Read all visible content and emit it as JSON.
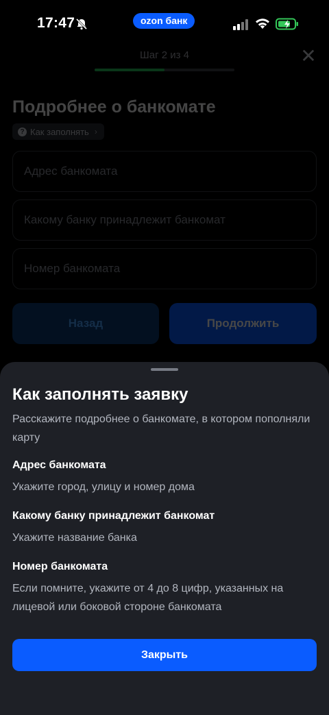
{
  "status_bar": {
    "time": "17:47",
    "bank_badge": "ozon банк",
    "icons": [
      "bell-slash-icon",
      "cellular-signal-icon",
      "wifi-icon",
      "battery-charging-icon"
    ]
  },
  "page": {
    "step": "Шаг 2 из 4",
    "progress_fraction": 0.5,
    "title": "Подробнее о банкомате",
    "how_to_fill": "Как заполнять",
    "fields": {
      "address_placeholder": "Адрес банкомата",
      "bank_placeholder": "Какому банку принадлежит банкомат",
      "number_placeholder": "Номер банкомата"
    },
    "back_label": "Назад",
    "continue_label": "Продолжить"
  },
  "sheet": {
    "title": "Как заполнять заявку",
    "description": "Расскажите подробнее о банкомате, в котором пополняли карту",
    "sections": [
      {
        "title": "Адрес банкомата",
        "text": "Укажите город, улицу и номер дома"
      },
      {
        "title": "Какому банку принадлежит банкомат",
        "text": "Укажите название банка"
      },
      {
        "title": "Номер банкомата",
        "text": "Если помните, укажите от 4 до 8 цифр, указанных на лицевой или боковой стороне банкомата"
      }
    ],
    "close_label": "Закрыть"
  },
  "colors": {
    "accent": "#0a5cff",
    "progress": "#27c25a",
    "sheet_bg": "#1e2026"
  }
}
